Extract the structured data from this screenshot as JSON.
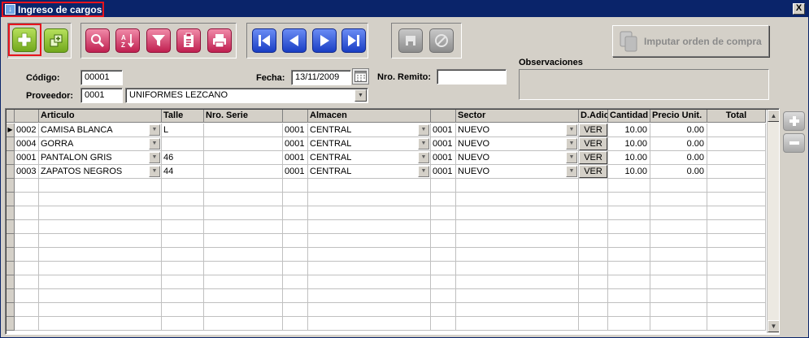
{
  "window": {
    "title": "Ingreso de cargos",
    "close_glyph": "X"
  },
  "toolbar": {
    "buttons": [
      {
        "name": "add-icon",
        "style": "green"
      },
      {
        "name": "add-multiple-icon",
        "style": "green"
      },
      {
        "name": "search-icon",
        "style": "pink"
      },
      {
        "name": "sort-az-icon",
        "style": "pink"
      },
      {
        "name": "filter-icon",
        "style": "pink"
      },
      {
        "name": "clipboard-icon",
        "style": "pink"
      },
      {
        "name": "print-icon",
        "style": "pink"
      },
      {
        "name": "first-record-icon",
        "style": "blue"
      },
      {
        "name": "previous-record-icon",
        "style": "blue"
      },
      {
        "name": "next-record-icon",
        "style": "blue"
      },
      {
        "name": "last-record-icon",
        "style": "blue"
      },
      {
        "name": "save-icon",
        "style": "gray"
      },
      {
        "name": "cancel-icon",
        "style": "gray"
      }
    ],
    "imputar_label": "Imputar orden de compra"
  },
  "form": {
    "codigo_label": "Código:",
    "codigo_value": "00001",
    "proveedor_label": "Proveedor:",
    "proveedor_code": "0001",
    "proveedor_name": "UNIFORMES LEZCANO",
    "fecha_label": "Fecha:",
    "fecha_value": "13/11/2009",
    "remito_label": "Nro. Remito:",
    "remito_value": "",
    "observaciones_label": "Observaciones",
    "observaciones_value": ""
  },
  "grid": {
    "headers": {
      "articulo": "Articulo",
      "talle": "Talle",
      "serie": "Nro. Serie",
      "almacen": "Almacen",
      "sector": "Sector",
      "dadic": "D.Adic",
      "cantidad": "Cantidad",
      "precio": "Precio Unit.",
      "total": "Total"
    },
    "rows": [
      {
        "art_code": "0002",
        "art_name": "CAMISA BLANCA",
        "talle": "L",
        "serie": "",
        "alm_code": "0001",
        "alm_name": "CENTRAL",
        "sec_code": "0001",
        "sec_name": "NUEVO",
        "dadic": "VER",
        "cantidad": "10.00",
        "precio": "0.00",
        "total": ""
      },
      {
        "art_code": "0004",
        "art_name": "GORRA",
        "talle": "",
        "serie": "",
        "alm_code": "0001",
        "alm_name": "CENTRAL",
        "sec_code": "0001",
        "sec_name": "NUEVO",
        "dadic": "VER",
        "cantidad": "10.00",
        "precio": "0.00",
        "total": ""
      },
      {
        "art_code": "0001",
        "art_name": "PANTALON GRIS",
        "talle": "46",
        "serie": "",
        "alm_code": "0001",
        "alm_name": "CENTRAL",
        "sec_code": "0001",
        "sec_name": "NUEVO",
        "dadic": "VER",
        "cantidad": "10.00",
        "precio": "0.00",
        "total": ""
      },
      {
        "art_code": "0003",
        "art_name": "ZAPATOS NEGROS",
        "talle": "44",
        "serie": "",
        "alm_code": "0001",
        "alm_name": "CENTRAL",
        "sec_code": "0001",
        "sec_name": "NUEVO",
        "dadic": "VER",
        "cantidad": "10.00",
        "precio": "0.00",
        "total": ""
      }
    ],
    "empty_rows": 11
  }
}
